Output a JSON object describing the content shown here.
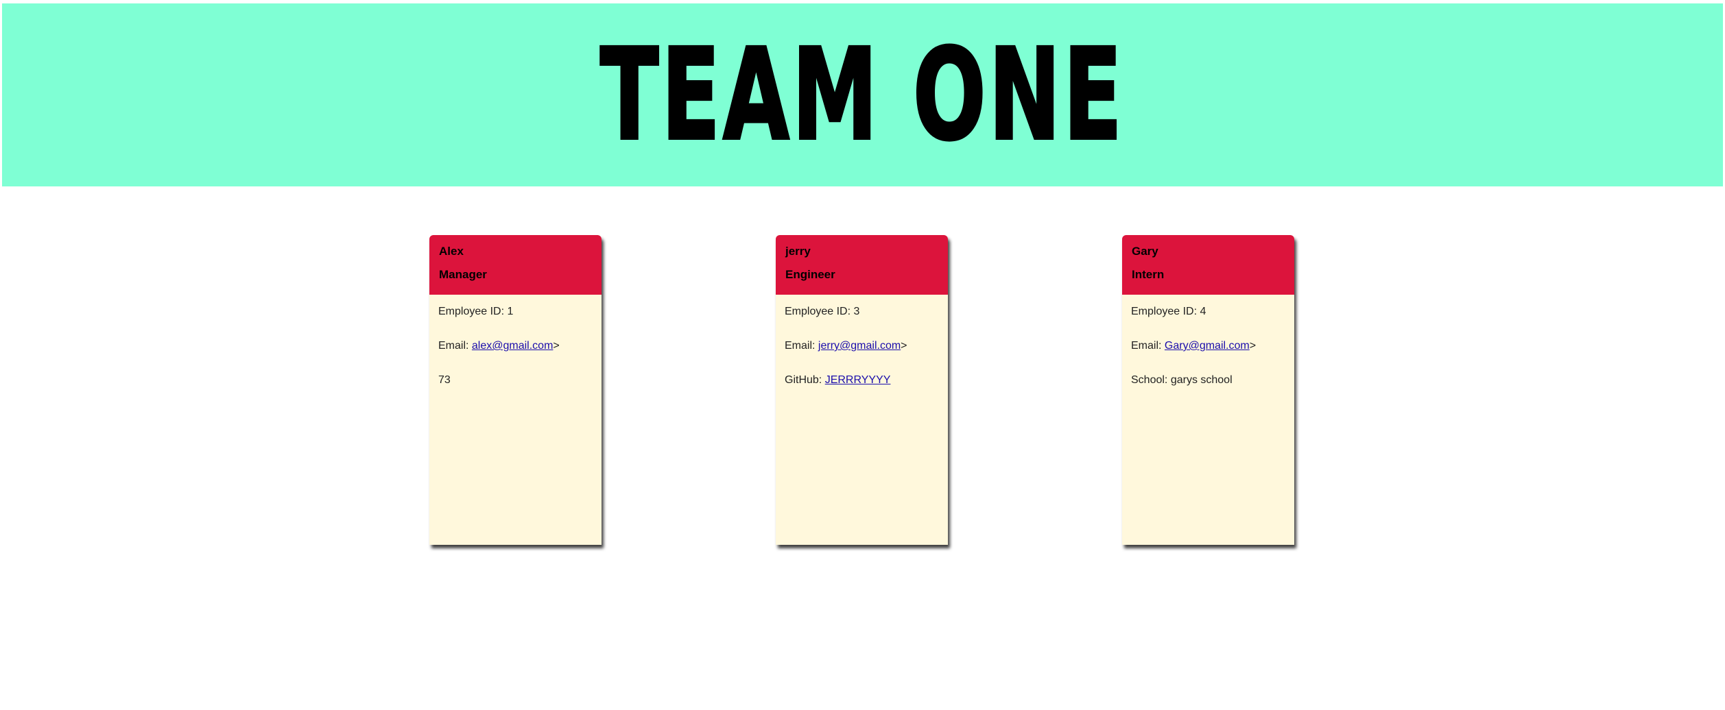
{
  "header": {
    "title": "TEAM ONE"
  },
  "cards": [
    {
      "name": "Alex",
      "role": "Manager",
      "id_label": "Employee ID: ",
      "id_value": "1",
      "email_label": "Email: ",
      "email": "alex@gmail.com",
      "email_suffix": ">",
      "extra_value": "73"
    },
    {
      "name": "jerry",
      "role": "Engineer",
      "id_label": "Employee ID: ",
      "id_value": "3",
      "email_label": "Email: ",
      "email": "jerry@gmail.com",
      "email_suffix": ">",
      "extra_label": "GitHub: ",
      "extra_link": "JERRRYYYY"
    },
    {
      "name": "Gary",
      "role": "Intern",
      "id_label": "Employee ID: ",
      "id_value": "4",
      "email_label": "Email: ",
      "email": "Gary@gmail.com",
      "email_suffix": ">",
      "extra_label": "School: ",
      "extra_value": "garys school"
    }
  ],
  "colors": {
    "banner": "#7fffd4",
    "card_header": "#dc143c",
    "card_body": "#fff8dc",
    "link": "#1a0dab"
  }
}
